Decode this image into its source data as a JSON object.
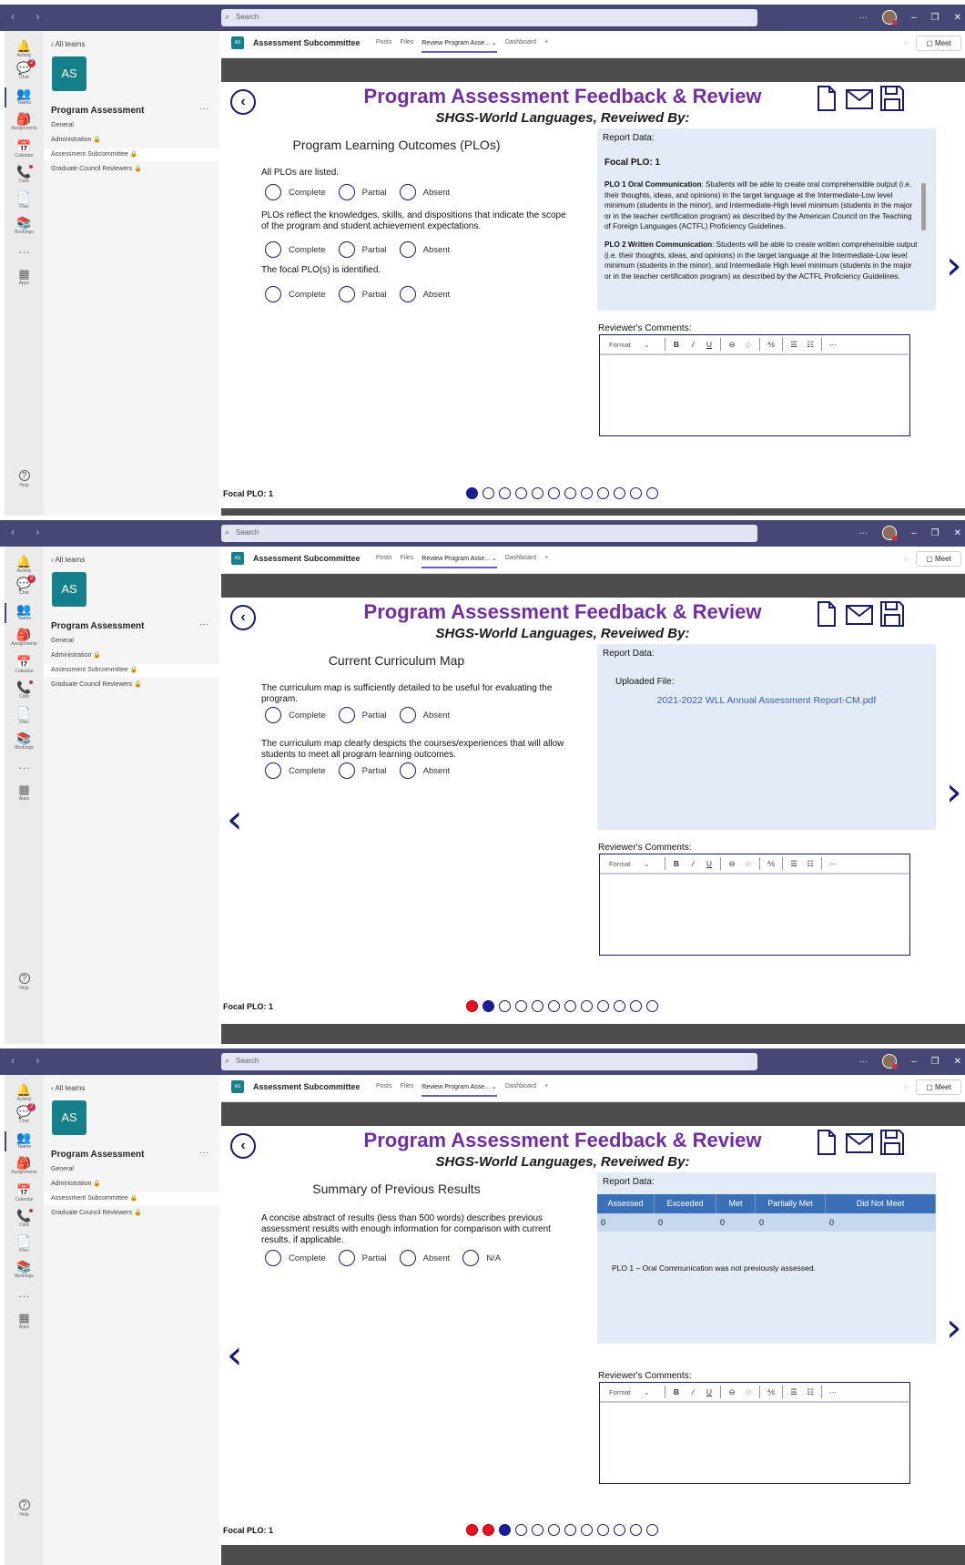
{
  "teams": {
    "search_placeholder": "Search",
    "nav_arrows": "‹ ›",
    "window_controls": [
      "···",
      "–",
      "❐",
      "✕"
    ],
    "rail": [
      {
        "label": "Activity",
        "icon": "bell-icon",
        "glyph": "🔔"
      },
      {
        "label": "Chat",
        "icon": "chat-icon",
        "glyph": "💬",
        "badge": "2"
      },
      {
        "label": "Teams",
        "icon": "teams-icon",
        "glyph": "👥",
        "active": true
      },
      {
        "label": "Assignments",
        "icon": "assignments-icon",
        "glyph": "🎒"
      },
      {
        "label": "Calendar",
        "icon": "calendar-icon",
        "glyph": "📅"
      },
      {
        "label": "Calls",
        "icon": "phone-icon",
        "glyph": "📞",
        "dot": true
      },
      {
        "label": "Files",
        "icon": "file-icon",
        "glyph": "📄"
      },
      {
        "label": "Bookings",
        "icon": "bookings-icon",
        "glyph": "📚"
      },
      {
        "label": "",
        "icon": "more-icon",
        "glyph": "···"
      },
      {
        "label": "Apps",
        "icon": "apps-icon",
        "glyph": "▦"
      }
    ],
    "help_label": "Help",
    "all_teams": "‹ All teams",
    "team_tile": "AS",
    "team_name": "Program Assessment",
    "team_more": "···",
    "channels": [
      "General",
      "Administration 🔒",
      "Assessment Subcommittee 🔒",
      "Graduate Council Reviewers 🔒"
    ],
    "header_tile": "AS",
    "header_title": "Assessment Subcommittee",
    "header_tabs": [
      "Posts",
      "Files",
      "Review Program Asse... ⌄",
      "Dashboard",
      "+"
    ],
    "meet": "▢ Meet"
  },
  "app": {
    "title": "Program Assessment Feedback & Review",
    "subtitle": "SHGS-World Languages, Reveiwed By:",
    "report_label": "Report Data:",
    "comments_label": "Reviewer's Comments:",
    "focal_footer": "Focal PLO: 1",
    "editor": {
      "format": "Format",
      "caret": "⌄",
      "bold": "B",
      "italic": "/",
      "underline": "U",
      "link": "⊖",
      "unlink": "⊘",
      "clear": "⅍",
      "bullets": "☰",
      "numbered": "☷",
      "more": "···"
    }
  },
  "screens": [
    {
      "section_title": "Program Learning Outcomes (PLOs)",
      "questions": [
        {
          "text": "All PLOs are listed.",
          "options": [
            "Complete",
            "Partial",
            "Absent"
          ]
        },
        {
          "text": "PLOs reflect the knowledges, skills, and dispositions that indicate the scope of the program and student achievement expectations.",
          "options": [
            "Complete",
            "Partial",
            "Absent"
          ]
        },
        {
          "text": "The focal PLO(s) is identified.",
          "options": [
            "Complete",
            "Partial",
            "Absent"
          ]
        }
      ],
      "focal_plo": "Focal PLO: 1",
      "plos": [
        {
          "name": "PLO 1 Oral Communication",
          "text": ": Students will be able to create oral comprehensible output (i.e. their thoughts, ideas, and opinions) in the target language at the Intermediate-Low level minimum (students in the minor), and Intermediate-High level minimum (students in the major or in the teacher certification program) as described by the American Council on the Teaching of Foreign Languages (ACTFL) Proficiency Guidelines."
        },
        {
          "name": "PLO 2 Written Communication",
          "text": ": Students will be able to create written comprehensible output (i.e. their thoughts, ideas, and opinions) in the target language at the Intermediate-Low level minimum (students in the minor), and Intermediate High level minimum (students in the major or in the teacher certification program) as described by the ACTFL Proficiency Guidelines."
        }
      ],
      "pager": [
        "cur",
        "",
        "",
        "",
        "",
        "",
        "",
        "",
        "",
        "",
        "",
        ""
      ]
    },
    {
      "section_title": "Current Curriculum Map",
      "questions": [
        {
          "text": "The curriculum map is sufficiently detailed to be useful for evaluating the program.",
          "options": [
            "Complete",
            "Partial",
            "Absent"
          ]
        },
        {
          "text": "The curriculum map clearly despicts the courses/experiences that will allow students to meet all program learning outcomes.",
          "options": [
            "Complete",
            "Partial",
            "Absent"
          ]
        }
      ],
      "uploaded_label": "Uploaded File:",
      "file_name": "2021-2022 WLL Annual Assessment Report-CM.pdf",
      "pager": [
        "done",
        "cur",
        "",
        "",
        "",
        "",
        "",
        "",
        "",
        "",
        "",
        ""
      ]
    },
    {
      "section_title": "Summary of Previous Results",
      "questions": [
        {
          "text": "A concise abstract of results (less than 500 words) describes previous assessment results with enough information for comparison with current results, if applicable.",
          "options": [
            "Complete",
            "Partial",
            "Absent",
            "N/A"
          ]
        }
      ],
      "table_headers": [
        "Assessed",
        "Exceeded",
        "Met",
        "Partially Met",
        "Did Not Meet"
      ],
      "table_values": [
        "0",
        "0",
        "0",
        "0",
        "0"
      ],
      "note": "PLO 1 – Oral Communication was not previously assessed.",
      "pager": [
        "done",
        "done",
        "cur",
        "",
        "",
        "",
        "",
        "",
        "",
        "",
        "",
        ""
      ]
    }
  ]
}
